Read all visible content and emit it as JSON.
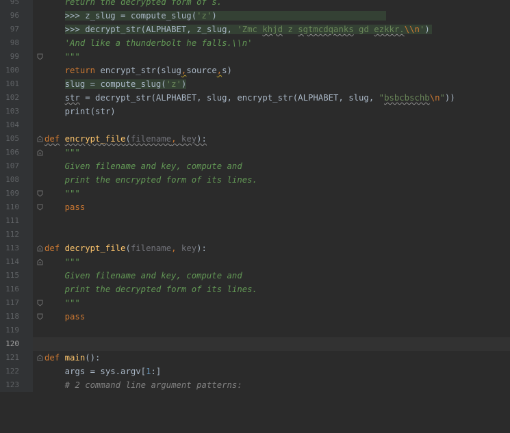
{
  "editor": {
    "lines": [
      {
        "n": "95",
        "text": "    return the decrypted form of s.",
        "style": "doc"
      },
      {
        "n": "96",
        "p1": "    ",
        "hl": ">>> z_slug = compute_slug(",
        "hls": "'z'",
        "hle": ")",
        "pad": "                                 "
      },
      {
        "n": "97",
        "p1": "    ",
        "a": ">>> decrypt_str(ALPHABET, z_slug, ",
        "b": "'Zmc ",
        "c": "khjd",
        "d": " z ",
        "e": "sgtmcdqanks",
        "f": " gd ",
        "g": "ezkkr.",
        "h": "\\\\n",
        "i": "'",
        "j": ")"
      },
      {
        "n": "98",
        "text": "    'And like a thunderbolt he falls.\\\\n'",
        "style": "doc"
      },
      {
        "n": "99",
        "text": "    \"\"\"",
        "style": "doc"
      },
      {
        "n": "100",
        "kw": "return",
        "rest1": " encrypt_str(slug",
        "c1": ",",
        "rest2": "source",
        "c2": ",",
        "rest3": "s)"
      },
      {
        "n": "101",
        "hl": "slug = compute_slug(",
        "hls": "'z'",
        "hle": ")"
      },
      {
        "n": "102",
        "v": "str",
        "a": " = decrypt_str(ALPHABET, slug, encrypt_str(ALPHABET, slug, ",
        "q": "\"",
        "s1": "bsbcbschb",
        "esc": "\\n",
        "q2": "\"",
        "end": "))"
      },
      {
        "n": "103",
        "a": "print(str)"
      },
      {
        "n": "104"
      },
      {
        "n": "105",
        "def": "def",
        "name": "encrypt_file",
        "op": "(",
        "p1": "filename",
        "sep": ", ",
        "p2": "key",
        "cl": "):"
      },
      {
        "n": "106",
        "text": "    \"\"\"",
        "style": "doc"
      },
      {
        "n": "107",
        "text": "    Given filename and key, compute and",
        "style": "doc"
      },
      {
        "n": "108",
        "text": "    print the encrypted form of its lines.",
        "style": "doc"
      },
      {
        "n": "109",
        "text": "    \"\"\"",
        "style": "doc"
      },
      {
        "n": "110",
        "text": "    pass",
        "style": "kw"
      },
      {
        "n": "111"
      },
      {
        "n": "112"
      },
      {
        "n": "113",
        "def": "def",
        "name": "decrypt_file",
        "op": "(",
        "p1": "filename",
        "sep": ", ",
        "p2": "key",
        "cl": "):"
      },
      {
        "n": "114",
        "text": "    \"\"\"",
        "style": "doc"
      },
      {
        "n": "115",
        "text": "    Given filename and key, compute and",
        "style": "doc"
      },
      {
        "n": "116",
        "text": "    print the decrypted form of its lines.",
        "style": "doc"
      },
      {
        "n": "117",
        "text": "    \"\"\"",
        "style": "doc"
      },
      {
        "n": "118",
        "text": "    pass",
        "style": "kw"
      },
      {
        "n": "119"
      },
      {
        "n": "120"
      },
      {
        "n": "121",
        "def": "def",
        "name": "main",
        "op": "():"
      },
      {
        "n": "122",
        "a": "    args = sys.argv[",
        "num": "1",
        "b": ":]"
      },
      {
        "n": "123",
        "text": "    # 2 command line argument patterns:",
        "style": "comment"
      }
    ]
  }
}
